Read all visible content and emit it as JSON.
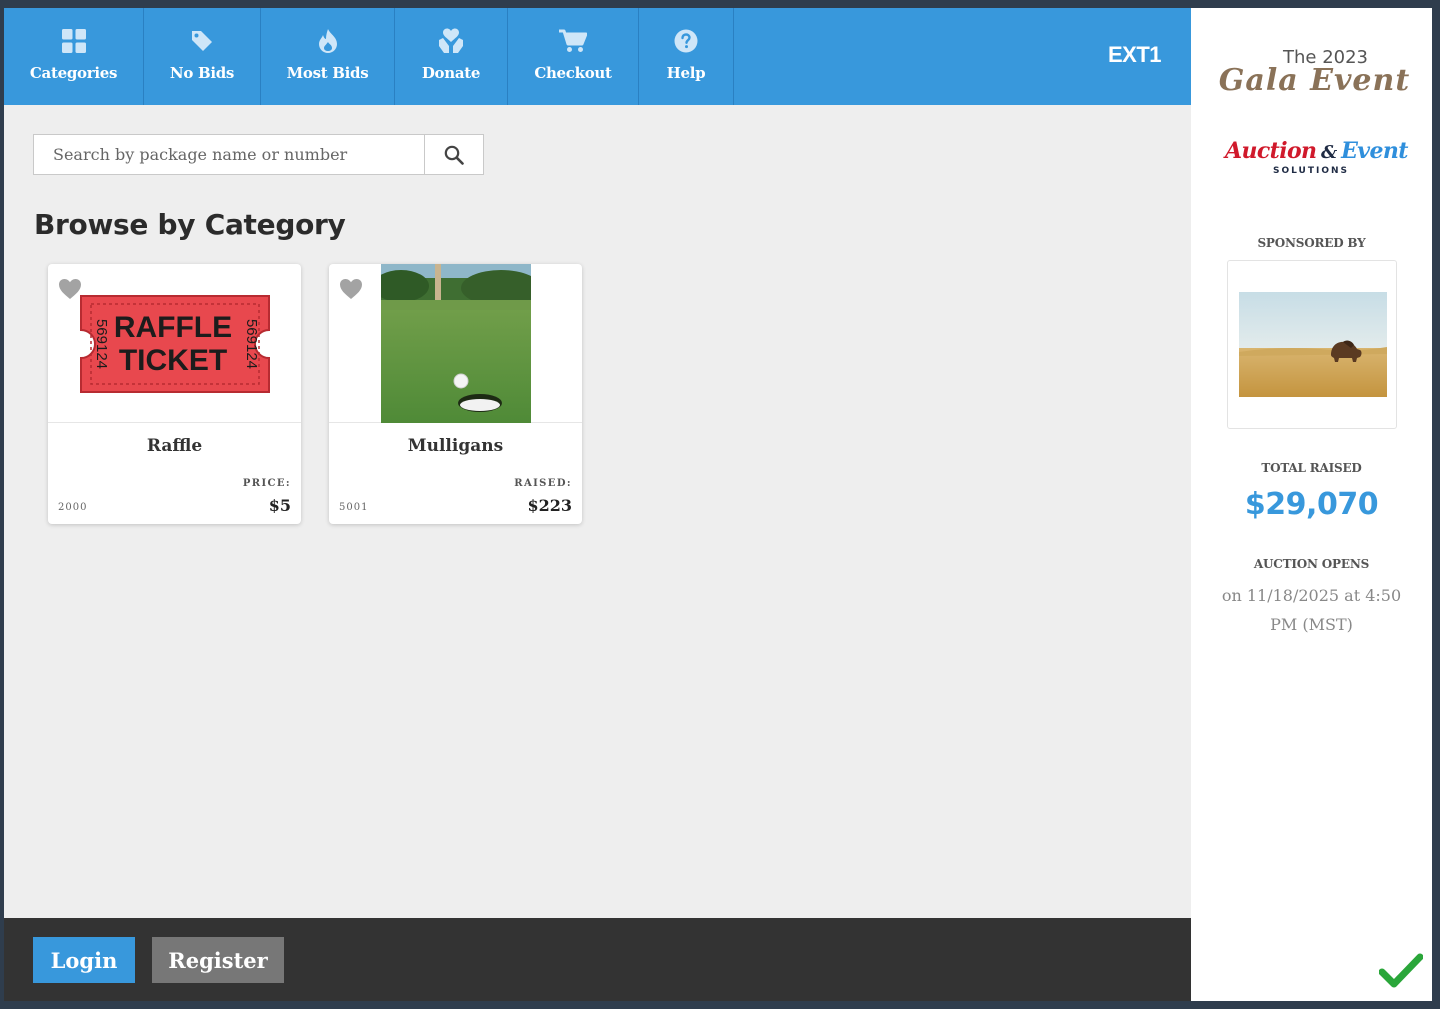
{
  "nav": {
    "items": [
      {
        "label": "Categories",
        "icon": "grid-icon"
      },
      {
        "label": "No Bids",
        "icon": "tag-icon"
      },
      {
        "label": "Most Bids",
        "icon": "fire-icon"
      },
      {
        "label": "Donate",
        "icon": "donate-hand-heart-icon"
      },
      {
        "label": "Checkout",
        "icon": "cart-icon"
      },
      {
        "label": "Help",
        "icon": "question-icon"
      }
    ],
    "event_code": "EXT1"
  },
  "search": {
    "placeholder": "Search by package name or number",
    "value": "",
    "button_icon": "search-icon"
  },
  "main": {
    "heading": "Browse by Category",
    "packages": [
      {
        "title": "Raffle",
        "amount_label": "PRICE:",
        "amount": "$5",
        "number": "2000",
        "image": "raffle-ticket-image",
        "ticket_text_1": "RAFFLE",
        "ticket_text_2": "TICKET",
        "ticket_serial": "569124"
      },
      {
        "title": "Mulligans",
        "amount_label": "RAISED:",
        "amount": "$223",
        "number": "5001",
        "image": "golf-hole-image"
      }
    ]
  },
  "footer": {
    "login_label": "Login",
    "register_label": "Register"
  },
  "sidebar": {
    "event_title_line1": "The 2023",
    "event_title_line2": "Gala Event",
    "brand_word1": "Auction",
    "brand_amp": "&",
    "brand_word2": "Event",
    "brand_sub": "SOLUTIONS",
    "sponsored_by_label": "SPONSORED BY",
    "sponsor_image": "bison-prairie-image",
    "total_raised_label": "TOTAL RAISED",
    "total_raised_value": "$29,070",
    "auction_opens_label": "AUCTION OPENS",
    "auction_opens_text": "on 11/18/2025 at 4:50 PM (MST)",
    "status_icon": "checkmark-icon"
  },
  "colors": {
    "primary_blue": "#3898dc",
    "dark_bar": "#333333",
    "register_gray": "#777777",
    "check_green": "#2aa63a",
    "brand_red": "#d0192b"
  }
}
